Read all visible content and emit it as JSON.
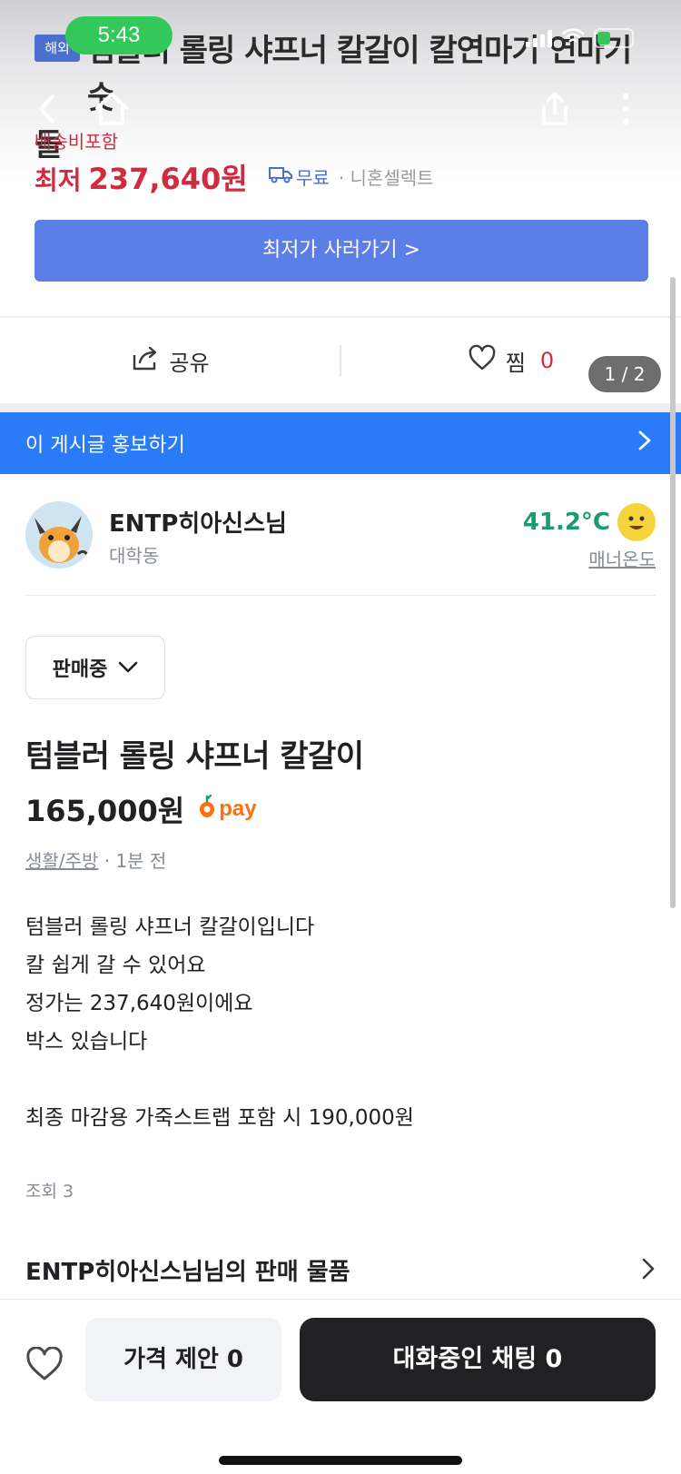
{
  "status_bar": {
    "time": "5:43"
  },
  "product_image": {
    "tag": "해외",
    "title_line1": "텀블러 롤링 샤프너 칼갈이 칼연마기 연마기 숫",
    "title_line2": "돌",
    "shipping_note": "배송비포함",
    "lowest_label": "최저",
    "lowest_price": "237,640원",
    "free_shipping": "무료",
    "seller": "니혼셀렉트",
    "buy_button": "최저가 사러가기 >"
  },
  "actions": {
    "share_label": "공유",
    "like_label": "찜",
    "like_count": "0"
  },
  "image_pager": "1 / 2",
  "promo_banner": {
    "label": "이 게시글 홍보하기"
  },
  "seller_profile": {
    "name": "ENTP히아신스님",
    "location": "대학동",
    "temperature": "41.2°C",
    "manner_label": "매너온도"
  },
  "sale_status": "판매중",
  "listing": {
    "title": "텀블러 롤링 샤프너 칼갈이",
    "price": "165,000원",
    "pay_label": "pay",
    "category": "생활/주방",
    "time_ago": "· 1분 전",
    "description": [
      "텀블러 롤링 샤프너 칼갈이입니다",
      "칼 쉽게 갈 수 있어요",
      "정가는 237,640원이에요",
      "박스 있습니다",
      "",
      "최종 마감용 가죽스트랩 포함 시 190,000원"
    ],
    "views": "조회 3"
  },
  "seller_items_title": "ENTP히아신스님님의 판매 물품",
  "bottom_bar": {
    "offer_button": "가격 제안 0",
    "chat_button": "대화중인 채팅 0"
  },
  "colors": {
    "brand_blue": "#2a7bf7",
    "price_red": "#d02c3f",
    "manner_green": "#1a9c6e",
    "carrot_orange": "#ff6f0f",
    "dark_button": "#212124"
  }
}
